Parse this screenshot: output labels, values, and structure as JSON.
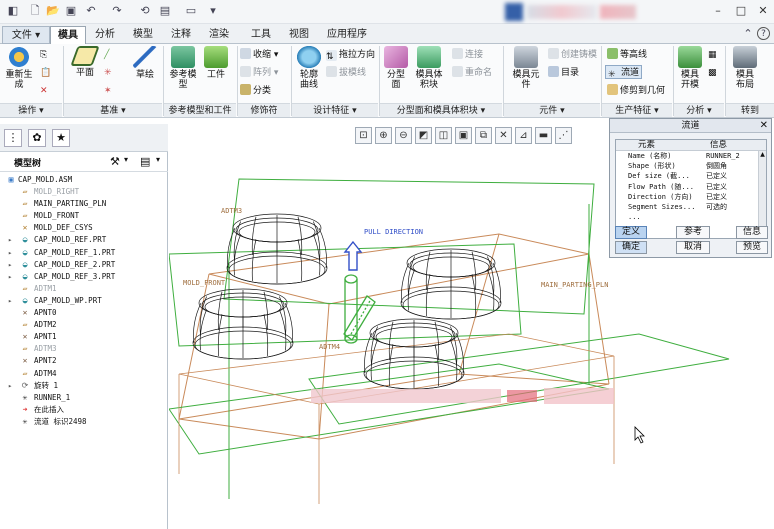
{
  "quick_access": {
    "icons": [
      "new-icon",
      "open-icon",
      "save-icon",
      "undo-icon",
      "redo-icon",
      "regenerate-icon",
      "window-icon",
      "folder-icon"
    ]
  },
  "window_controls": {
    "help": "?",
    "minimize": "–",
    "restore": "□",
    "close": "✕"
  },
  "tabs": [
    "文件",
    "模具",
    "分析",
    "模型",
    "注释",
    "渲染",
    "工具",
    "视图",
    "应用程序"
  ],
  "ribbon": {
    "operations": {
      "regenerate_label": "重新生\n成",
      "group": "操作"
    },
    "datum": {
      "plane_label": "平面",
      "sketch_label": "草绘",
      "group": "基准"
    },
    "ref_model": {
      "ref_model_label": "参考模\n型",
      "workpiece_label": "工件",
      "group": "参考模型和工件"
    },
    "modifiers": {
      "shrink": "收缩",
      "pattern": "阵列",
      "split": "分类",
      "group": "修饰符"
    },
    "design_features": {
      "contour_curve": "轮廓\n曲线",
      "pull_direction": "拖拉方向",
      "slice": "拔模线",
      "group": "设计特征"
    },
    "parting": {
      "parting_surface": "分型\n面",
      "mold_volume": "模具体\n积块",
      "connect": "连接",
      "rename": "重命名",
      "group": "分型面和模具体积块"
    },
    "components": {
      "mold_component": "模具元\n件",
      "create_casting": "创建铸模",
      "catalog": "目录",
      "group": "元件"
    },
    "production": {
      "isoline": "等高线",
      "runner": "流道",
      "trim_geometry": "修剪到几何",
      "group": "生产特征"
    },
    "analysis": {
      "mold_open": "模具\n开模",
      "group": "分析"
    },
    "goto": {
      "mold_layout": "模具\n布局",
      "group": "转到"
    }
  },
  "sidebar": {
    "header": "模型树",
    "tree": [
      {
        "label": "CAP_MOLD.ASM",
        "icon": "assembly-icon",
        "root": true
      },
      {
        "label": "MOLD_RIGHT",
        "icon": "datum-plane-icon",
        "faded": true
      },
      {
        "label": "MAIN_PARTING_PLN",
        "icon": "datum-plane-icon"
      },
      {
        "label": "MOLD_FRONT",
        "icon": "datum-plane-icon"
      },
      {
        "label": "MOLD_DEF_CSYS",
        "icon": "csys-icon"
      },
      {
        "label": "CAP_MOLD_REF.PRT",
        "icon": "part-icon",
        "expand": true
      },
      {
        "label": "CAP_MOLD_REF_1.PRT",
        "icon": "part-icon",
        "expand": true
      },
      {
        "label": "CAP_MOLD_REF_2.PRT",
        "icon": "part-icon",
        "expand": true
      },
      {
        "label": "CAP_MOLD_REF_3.PRT",
        "icon": "part-icon",
        "expand": true
      },
      {
        "label": "ADTM1",
        "icon": "datum-plane-icon",
        "faded": true
      },
      {
        "label": "CAP_MOLD_WP.PRT",
        "icon": "part-icon",
        "expand": true
      },
      {
        "label": "APNT0",
        "icon": "datum-point-icon"
      },
      {
        "label": "ADTM2",
        "icon": "datum-plane-icon"
      },
      {
        "label": "APNT1",
        "icon": "datum-point-icon"
      },
      {
        "label": "ADTM3",
        "icon": "datum-plane-icon",
        "faded": true
      },
      {
        "label": "APNT2",
        "icon": "datum-point-icon"
      },
      {
        "label": "ADTM4",
        "icon": "datum-plane-icon"
      },
      {
        "label": "旋转 1",
        "icon": "revolve-icon",
        "expand": true
      },
      {
        "label": "RUNNER_1",
        "icon": "runner-icon"
      },
      {
        "label": "在此插入",
        "icon": "insert-here-icon"
      },
      {
        "label": "流道 标识2498",
        "icon": "runner-icon"
      }
    ]
  },
  "viewport": {
    "labels": {
      "adtm3": "ADTM3",
      "pull_direction": "PULL DIRECTION",
      "mold_front": "MOLD_FRONT",
      "main_parting": "MAIN_PARTING_PLN",
      "adtm4": "ADTM4"
    }
  },
  "dialog": {
    "title": "流道",
    "col_element": "元素",
    "col_info": "信息",
    "rows": [
      {
        "element": "Name (名称)",
        "info": "RUNNER_2"
      },
      {
        "element": "Shape (形状)",
        "info": "倒圆角"
      },
      {
        "element": "Def size (截...",
        "info": "已定义"
      },
      {
        "element": "Flow Path (随...",
        "info": "已定义"
      },
      {
        "element": "Direction (方向)",
        "info": "已定义"
      },
      {
        "element": "Segment Sizes...",
        "info": "可选的"
      },
      {
        "element": "...",
        "info": ""
      }
    ],
    "buttons": {
      "define": "定义",
      "refs": "参考",
      "info": "信息",
      "ok": "确定",
      "cancel": "取消",
      "preview": "预览"
    }
  },
  "colors": {
    "wire_green": "#3fae3f",
    "wire_orange": "#c98a5a",
    "datum_label": "#a07040",
    "pull_blue": "#3350c8"
  }
}
